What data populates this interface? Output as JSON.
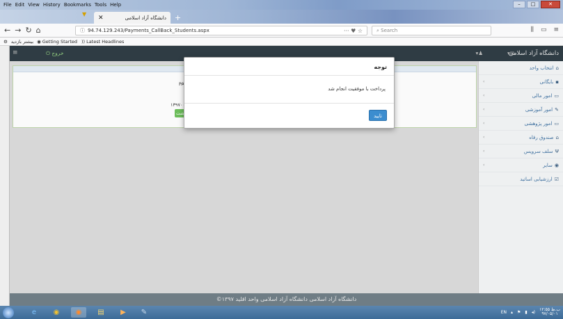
{
  "browser": {
    "menu": [
      "File",
      "Edit",
      "View",
      "History",
      "Bookmarks",
      "Tools",
      "Help"
    ],
    "tab_title": "دانشگاه آزاد اسلامی",
    "new_tab": "+",
    "url": "94.74.129.243/Payments_CallBack_Students.aspx",
    "search_placeholder": "Search",
    "bookmarks": [
      "بیشتر بازدید",
      "Getting Started",
      "Latest Headlines"
    ]
  },
  "app": {
    "brand": "دانشگاه آزاد اسلامی",
    "exit_label": "خروج",
    "sidebar": [
      {
        "label": "انتخاب واحد",
        "icon": "home-icon"
      },
      {
        "label": "بایگانی",
        "icon": "archive-icon"
      },
      {
        "label": "امور مالی",
        "icon": "money-icon"
      },
      {
        "label": "امور آموزشی",
        "icon": "pencil-icon"
      },
      {
        "label": "امور پژوهشی",
        "icon": "monitor-icon"
      },
      {
        "label": "صندوق رفاه",
        "icon": "bank-icon"
      },
      {
        "label": "سلف سرویس",
        "icon": "food-icon"
      },
      {
        "label": "سایر",
        "icon": "circle-icon"
      },
      {
        "label": "ارزشیابی اساتید",
        "icon": "check-icon"
      }
    ],
    "panel_text1": "PAY",
    "panel_text2": "۱۳۹۷۰۰۵۷۴۳",
    "panel_button": "بازگشت",
    "footer": "©۱۳۹۷ دانشگاه آزاد اسلامی دانشگاه آزاد اسلامی واحد اقلید"
  },
  "modal": {
    "title": "توجه",
    "body": "پرداخت با موفقیت انجام شد",
    "ok": "تایید"
  },
  "taskbar": {
    "lang": "EN",
    "time": "۱۲:۵۵ ب.ظ",
    "date": "۹۷/۰۵/۰۱"
  }
}
